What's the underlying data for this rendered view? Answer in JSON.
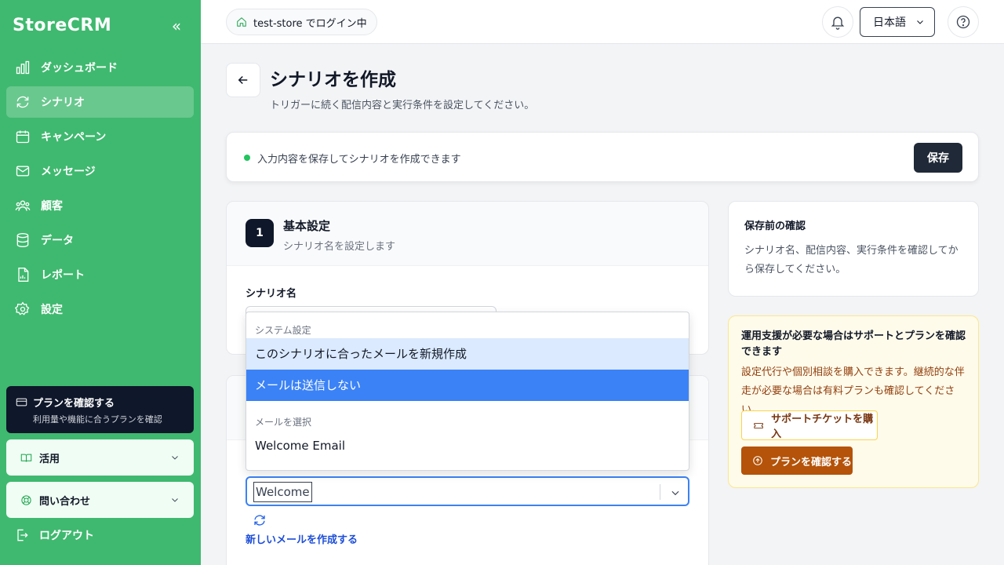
{
  "brand": "StoreCRM",
  "sidebar": {
    "items": [
      {
        "label": "ダッシュボード",
        "icon": "bar-chart-icon"
      },
      {
        "label": "シナリオ",
        "icon": "refresh-cycle-icon",
        "active": true
      },
      {
        "label": "キャンペーン",
        "icon": "calendar-icon"
      },
      {
        "label": "メッセージ",
        "icon": "mail-icon"
      },
      {
        "label": "顧客",
        "icon": "users-icon"
      },
      {
        "label": "データ",
        "icon": "database-icon"
      },
      {
        "label": "レポート",
        "icon": "report-icon"
      },
      {
        "label": "設定",
        "icon": "gear-icon"
      }
    ],
    "plan_card": {
      "title": "プランを確認する",
      "subtitle": "利用量や機能に合うプランを確認"
    },
    "accordion_use": "活用",
    "accordion_contact": "問い合わせ",
    "logout": "ログアウト"
  },
  "topbar": {
    "store_label": "test-store でログイン中",
    "language": "日本語"
  },
  "header": {
    "title": "シナリオを作成",
    "subtitle": "トリガーに続く配信内容と実行条件を設定してください。"
  },
  "status": {
    "text": "入力内容を保存してシナリオを作成できます",
    "save_label": "保存"
  },
  "section1": {
    "step": "1",
    "title": "基本設定",
    "subtitle": "シナリオ名を設定します",
    "field_label": "シナリオ名"
  },
  "dropdown": {
    "group_system": "システム設定",
    "opt_create": "このシナリオに合ったメールを新規作成",
    "opt_none": "メールは送信しない",
    "group_mail": "メールを選択",
    "opt_welcome": "Welcome Email"
  },
  "mail_select": {
    "value": "Welcome",
    "new_mail_link": "新しいメールを作成する"
  },
  "confirm": {
    "title": "保存前の確認",
    "desc": "シナリオ名、配信内容、実行条件を確認してから保存してください。"
  },
  "support": {
    "title": "運用支援が必要な場合はサポートとプランを確認できます",
    "desc": "設定代行や個別相談を購入できます。継続的な伴走が必要な場合は有料プランも確認してください。",
    "ticket_label": "サポートチケットを購入",
    "plan_label": "プランを確認する"
  },
  "colors": {
    "sidebar": "#3fb96f",
    "accent": "#3b82f6",
    "dark": "#0f172a",
    "support_btn": "#b45309"
  }
}
